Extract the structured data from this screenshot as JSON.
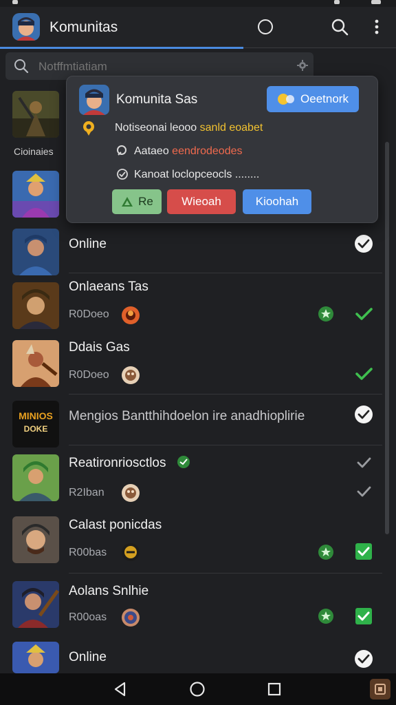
{
  "appbar": {
    "title": "Komunitas",
    "icons": [
      "avatar",
      "circle-icon",
      "search-icon",
      "more-vert-icon"
    ]
  },
  "search": {
    "placeholder": "Notffmtiatiam",
    "icons": [
      "search-icon",
      "settings-icon"
    ]
  },
  "popup": {
    "title": "Komunita Sas",
    "top_button": "Oeetnork",
    "line1_prefix": "Notiseonai leooo",
    "line1_highlight": "sanld eoabet",
    "line2_prefix": "Aataeo",
    "line2_highlight": "eendrodeodes",
    "line3": "Kanoat loclopceocls ........",
    "button_re": "Re",
    "button_wieoah": "Wieoah",
    "button_kioohah": "Kioohah",
    "colors": {
      "blue": "#4f8fe8",
      "green": "#86c48a",
      "red": "#d64d4a"
    }
  },
  "sidebar_label": "Cioinaies",
  "list": [
    {
      "name": "Online",
      "sub": "",
      "check": "white"
    },
    {
      "name": "Onlaeans Tas",
      "sub": "R0Doeo",
      "star": true,
      "check": "green"
    },
    {
      "name": "Ddais Gas",
      "sub": "R0Doeo",
      "star": false,
      "check": "green"
    },
    {
      "name": "Mengios Bantthihdoelon ire anadhioplirie",
      "sub": "",
      "check": "white"
    },
    {
      "name": "Reatironriosctlos",
      "sub": "R2Iban",
      "star": false,
      "check": "grey"
    },
    {
      "name": "Calast ponicdas",
      "sub": "R00bas",
      "star": true,
      "check": "green-box"
    },
    {
      "name": "Aolans Snlhie",
      "sub": "R00oas",
      "star": true,
      "check": "green-box"
    },
    {
      "name": "Online",
      "sub": "",
      "check": "white"
    }
  ],
  "game_logo_text": [
    "MINIOS",
    "DOKE"
  ],
  "navbar": {
    "icons": [
      "back-icon",
      "home-icon",
      "recents-icon",
      "app-thumb-icon"
    ]
  }
}
